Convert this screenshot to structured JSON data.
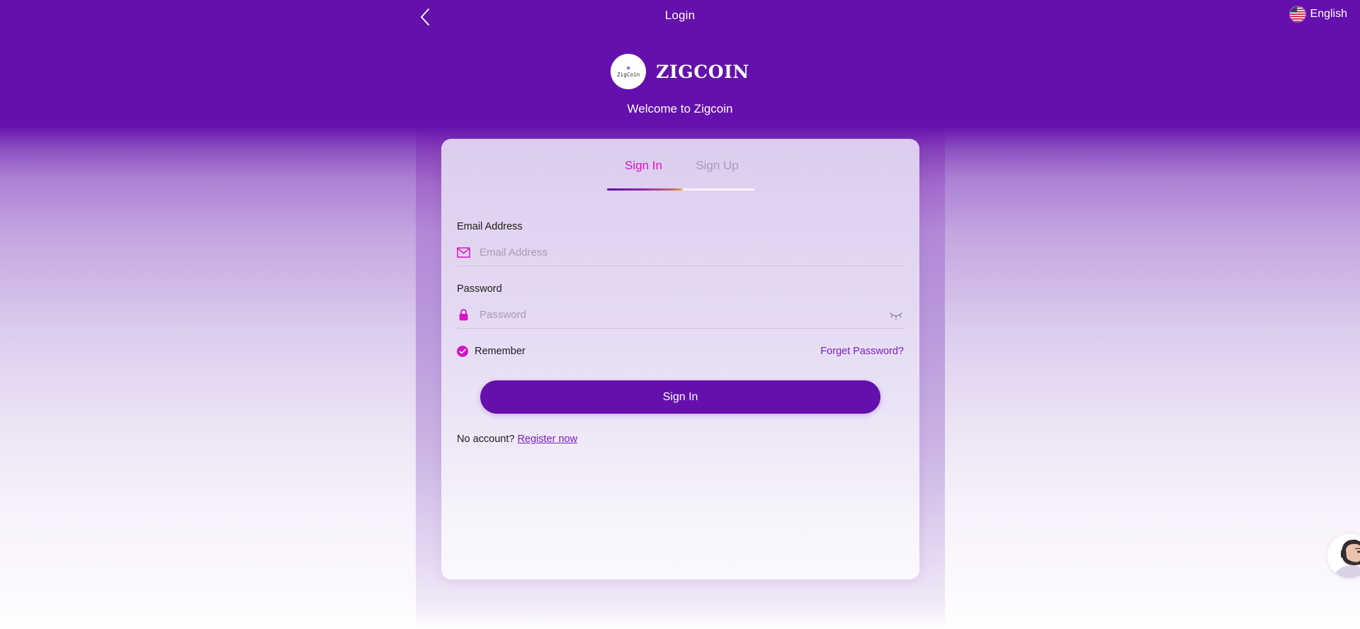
{
  "header": {
    "title": "Login",
    "back_icon": "chevron-left-icon",
    "language": {
      "label": "English",
      "flag_icon": "us-flag-icon"
    }
  },
  "brand": {
    "logo_inner_text": "ZigCoin",
    "logo_star_icon": "star-icon",
    "wordmark": "ZIGCOIN",
    "welcome": "Welcome to Zigcoin"
  },
  "tabs": [
    {
      "label": "Sign In",
      "active": true
    },
    {
      "label": "Sign Up",
      "active": false
    }
  ],
  "form": {
    "email": {
      "label": "Email Address",
      "placeholder": "Email Address",
      "value": "",
      "icon": "envelope-icon"
    },
    "password": {
      "label": "Password",
      "placeholder": "Password",
      "value": "",
      "icon": "lock-icon",
      "toggle_icon": "eye-slash-icon"
    },
    "remember": {
      "label": "Remember",
      "checked": true,
      "icon": "check-circle-icon"
    },
    "forget_password": "Forget Password?",
    "submit_label": "Sign In",
    "register_prompt": "No account?",
    "register_link": "Register now"
  },
  "support": {
    "icon": "support-agent-avatar"
  },
  "colors": {
    "brand_purple": "#6410ac",
    "accent_magenta": "#d812c8",
    "link_purple": "#7a1fbe",
    "tab_inactive": "#a89bb2"
  }
}
